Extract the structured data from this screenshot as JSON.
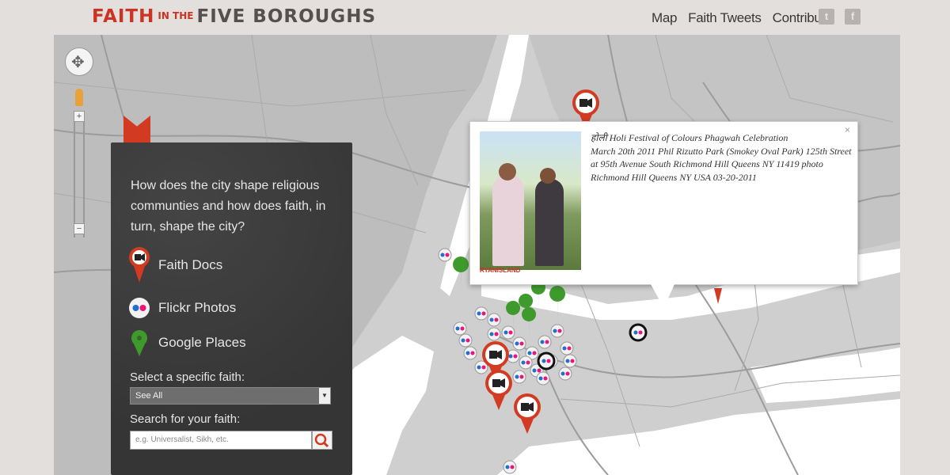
{
  "header": {
    "logo_part1": "FAITH",
    "logo_part2": "IN THE",
    "logo_part3": "FIVE BOROUGHS",
    "nav": [
      "Map",
      "Faith Tweets",
      "Contribute"
    ],
    "social": {
      "twitter_icon": "t",
      "facebook_icon": "f"
    }
  },
  "sidebar": {
    "question": "How does the city shape religious communties and how does faith, in turn, shape the city?",
    "legend": [
      {
        "label": "Faith Docs",
        "icon": "video-marker-icon"
      },
      {
        "label": "Flickr Photos",
        "icon": "flickr-icon"
      },
      {
        "label": "Google Places",
        "icon": "google-place-marker-icon"
      }
    ],
    "select_label": "Select a specific faith:",
    "select_value": "See All",
    "search_label": "Search for your faith:",
    "search_placeholder": "e.g. Universalist, Sikh, etc."
  },
  "popup": {
    "title": "होली Holi Festival of Colours Phagwah Celebration",
    "body": "March 20th 2011 Phil Rizutto Park (Smokey Oval Park) 125th Street at 95th Avenue South Richmond Hill Queens NY 11419 photo Richmond Hill Queens NY USA 03-20-2011",
    "photo_credit": "RYANISLAND",
    "close_icon": "×"
  },
  "colors": {
    "accent": "#cc3322",
    "panel": "#3a3a3a",
    "google_marker": "#3f9a2e",
    "flickr_blue": "#1f6fd0",
    "flickr_pink": "#f0127a"
  }
}
